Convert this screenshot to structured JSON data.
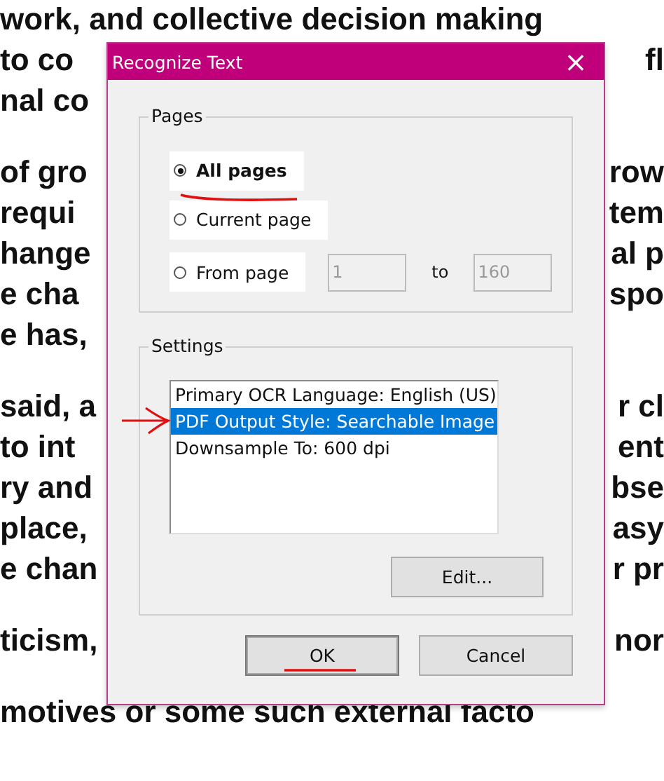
{
  "document": {
    "paragraphs": [
      [
        {
          "left": "work, and collective decision making"
        },
        {
          "left": "to co",
          "right": "fl"
        },
        {
          "left": "nal co"
        }
      ],
      [
        {
          "left": "of gro",
          "right": "row"
        },
        {
          "left": "requi",
          "right": "tem"
        },
        {
          "left": "hange",
          "right": "al p"
        },
        {
          "left": "e cha",
          "right": "spo"
        },
        {
          "left": "e has,"
        }
      ],
      [
        {
          "left": "said, a",
          "right": "r cl"
        },
        {
          "left": "to int",
          "right": "ent"
        },
        {
          "left": "ry and",
          "right": "bse"
        },
        {
          "left": "place,",
          "right": "asy"
        },
        {
          "left": "e chan",
          "right": "r pr"
        }
      ],
      [
        {
          "left": "ticism,",
          "right": "nor"
        }
      ],
      [
        {
          "left": "motives or some such external facto"
        }
      ]
    ]
  },
  "dialog": {
    "title": "Recognize Text",
    "close": "×",
    "pages": {
      "label": "Pages",
      "options": [
        {
          "kind": "plain",
          "label": "All pages",
          "selected": true
        },
        {
          "kind": "plain",
          "label": "Current page",
          "selected": false
        },
        {
          "kind": "range",
          "label": "From page",
          "selected": false,
          "from": "1",
          "to_label": "to",
          "to": "160",
          "disabled": true
        }
      ]
    },
    "settings": {
      "label": "Settings",
      "items": [
        {
          "label": "Primary OCR Language: English (US)",
          "selected": false
        },
        {
          "label": "PDF Output Style: Searchable Image",
          "selected": true
        },
        {
          "label": "Downsample To: 600 dpi",
          "selected": false
        }
      ],
      "edit_button": "Edit..."
    },
    "buttons": [
      {
        "label": "OK",
        "default": true
      },
      {
        "label": "Cancel",
        "default": false
      }
    ]
  }
}
